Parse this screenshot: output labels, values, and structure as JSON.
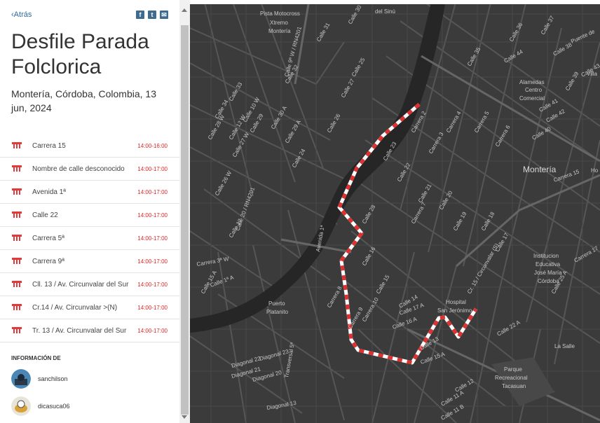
{
  "sidebar": {
    "back_label": "Atrás",
    "share_icons": [
      "facebook-icon",
      "twitter-icon",
      "mail-icon"
    ],
    "title": "Desfile Parada Folclorica",
    "subtitle": "Montería, Córdoba, Colombia, 13 jun, 2024",
    "streets": [
      {
        "name": "Carrera 15",
        "time": "14:00-16:00"
      },
      {
        "name": "Nombre de calle desconocido",
        "time": "14:00-17:00"
      },
      {
        "name": "Avenida 1ª",
        "time": "14:00-17:00"
      },
      {
        "name": "Calle 22",
        "time": "14:00-17:00"
      },
      {
        "name": "Carrera 5ª",
        "time": "14:00-17:00"
      },
      {
        "name": "Carrera 9ª",
        "time": "14:00-17:00"
      },
      {
        "name": "Cll. 13 / Av. Circunvalar del Sur",
        "time": "14:00-17:00"
      },
      {
        "name": "Cr.14 / Av. Circunvalar >(N)",
        "time": "14:00-17:00"
      },
      {
        "name": "Tr. 13 / Av. Circunvalar del Sur",
        "time": "14:00-17:00"
      }
    ],
    "info_heading": "INFORMACIÓN DE",
    "users": [
      {
        "name": "sanchilson"
      },
      {
        "name": "dicasuca06"
      }
    ]
  },
  "map": {
    "labels": {
      "pista": "Pista Motocross",
      "xtremo": "Xtremo",
      "monteria_small": "Montería",
      "monteria_big": "Montería",
      "alamedas": "Alamedas",
      "centro": "Centro",
      "comercial": "Comercial",
      "puerto": "Puerto",
      "platanito": "Platanito",
      "hospital": "Hospital",
      "san_jeronimo": "San Jerónimo",
      "institucion": "Institucion",
      "educativa": "Educativa",
      "jose_maria": "José María",
      "cordoba": "Córdoba",
      "la_salle": "La Salle",
      "parque": "Parque",
      "recreacional": "Recreacional",
      "tacasuan": "Tacasuan",
      "sinu": "del Sinú",
      "villa": "Villa",
      "ho": "Ho",
      "puente": "Puente de"
    },
    "streets": [
      "Calle 30",
      "Calle 31",
      "Calle 32",
      "Calle 33",
      "Calle 34",
      "Calle 29",
      "Calle 27",
      "Calle 26",
      "Calle 25",
      "Calle 24",
      "Calle 23",
      "Calle 22",
      "Calle 21",
      "Calle 20",
      "Calle 19",
      "Calle 18",
      "Calle 17",
      "Calle 16",
      "Calle 15",
      "Calle 14",
      "Calle 13",
      "Calle 12",
      "Calle 11 A",
      "Calle 11 B",
      "Carrera 2",
      "Carrera 3",
      "Carrera 4",
      "Carrera 5",
      "Carrera 6",
      "Carrera 7",
      "Carrera 8",
      "Carrera 9",
      "Carrera 10",
      "Carrera 15",
      "Diagonal 22",
      "Diagonal 21",
      "Diagonal 20",
      "Diagonal 23",
      "Calle 41",
      "Calle 44",
      "Calle 42",
      "Calle 35",
      "Calle 36",
      "Calle 37",
      "Calle 38",
      "Calle 39",
      "Calle 40",
      "Calle 43",
      "Carrera 17",
      "Avenida 1ª",
      "Calle 16 A",
      "Calle 17 A",
      "Calle 15 A",
      "Calle 22 A",
      "Calle 12 W",
      "Calle 10 W",
      "Calle 28 W",
      "Calle 27 W",
      "Calle 26 W",
      "Calle 1ª A",
      "Calle 15 A",
      "Carrera 3ª W",
      "Calle 17",
      "Transversal 5ª",
      "Diagonal 13",
      "Cr. 15 / Circunvalar (S)",
      "Calle 20 / RN4201",
      "Calle 9ª W / RN4201",
      "Calle 30 A",
      "Calle 29 A",
      "Calle 28",
      "Calle 25 A"
    ]
  }
}
